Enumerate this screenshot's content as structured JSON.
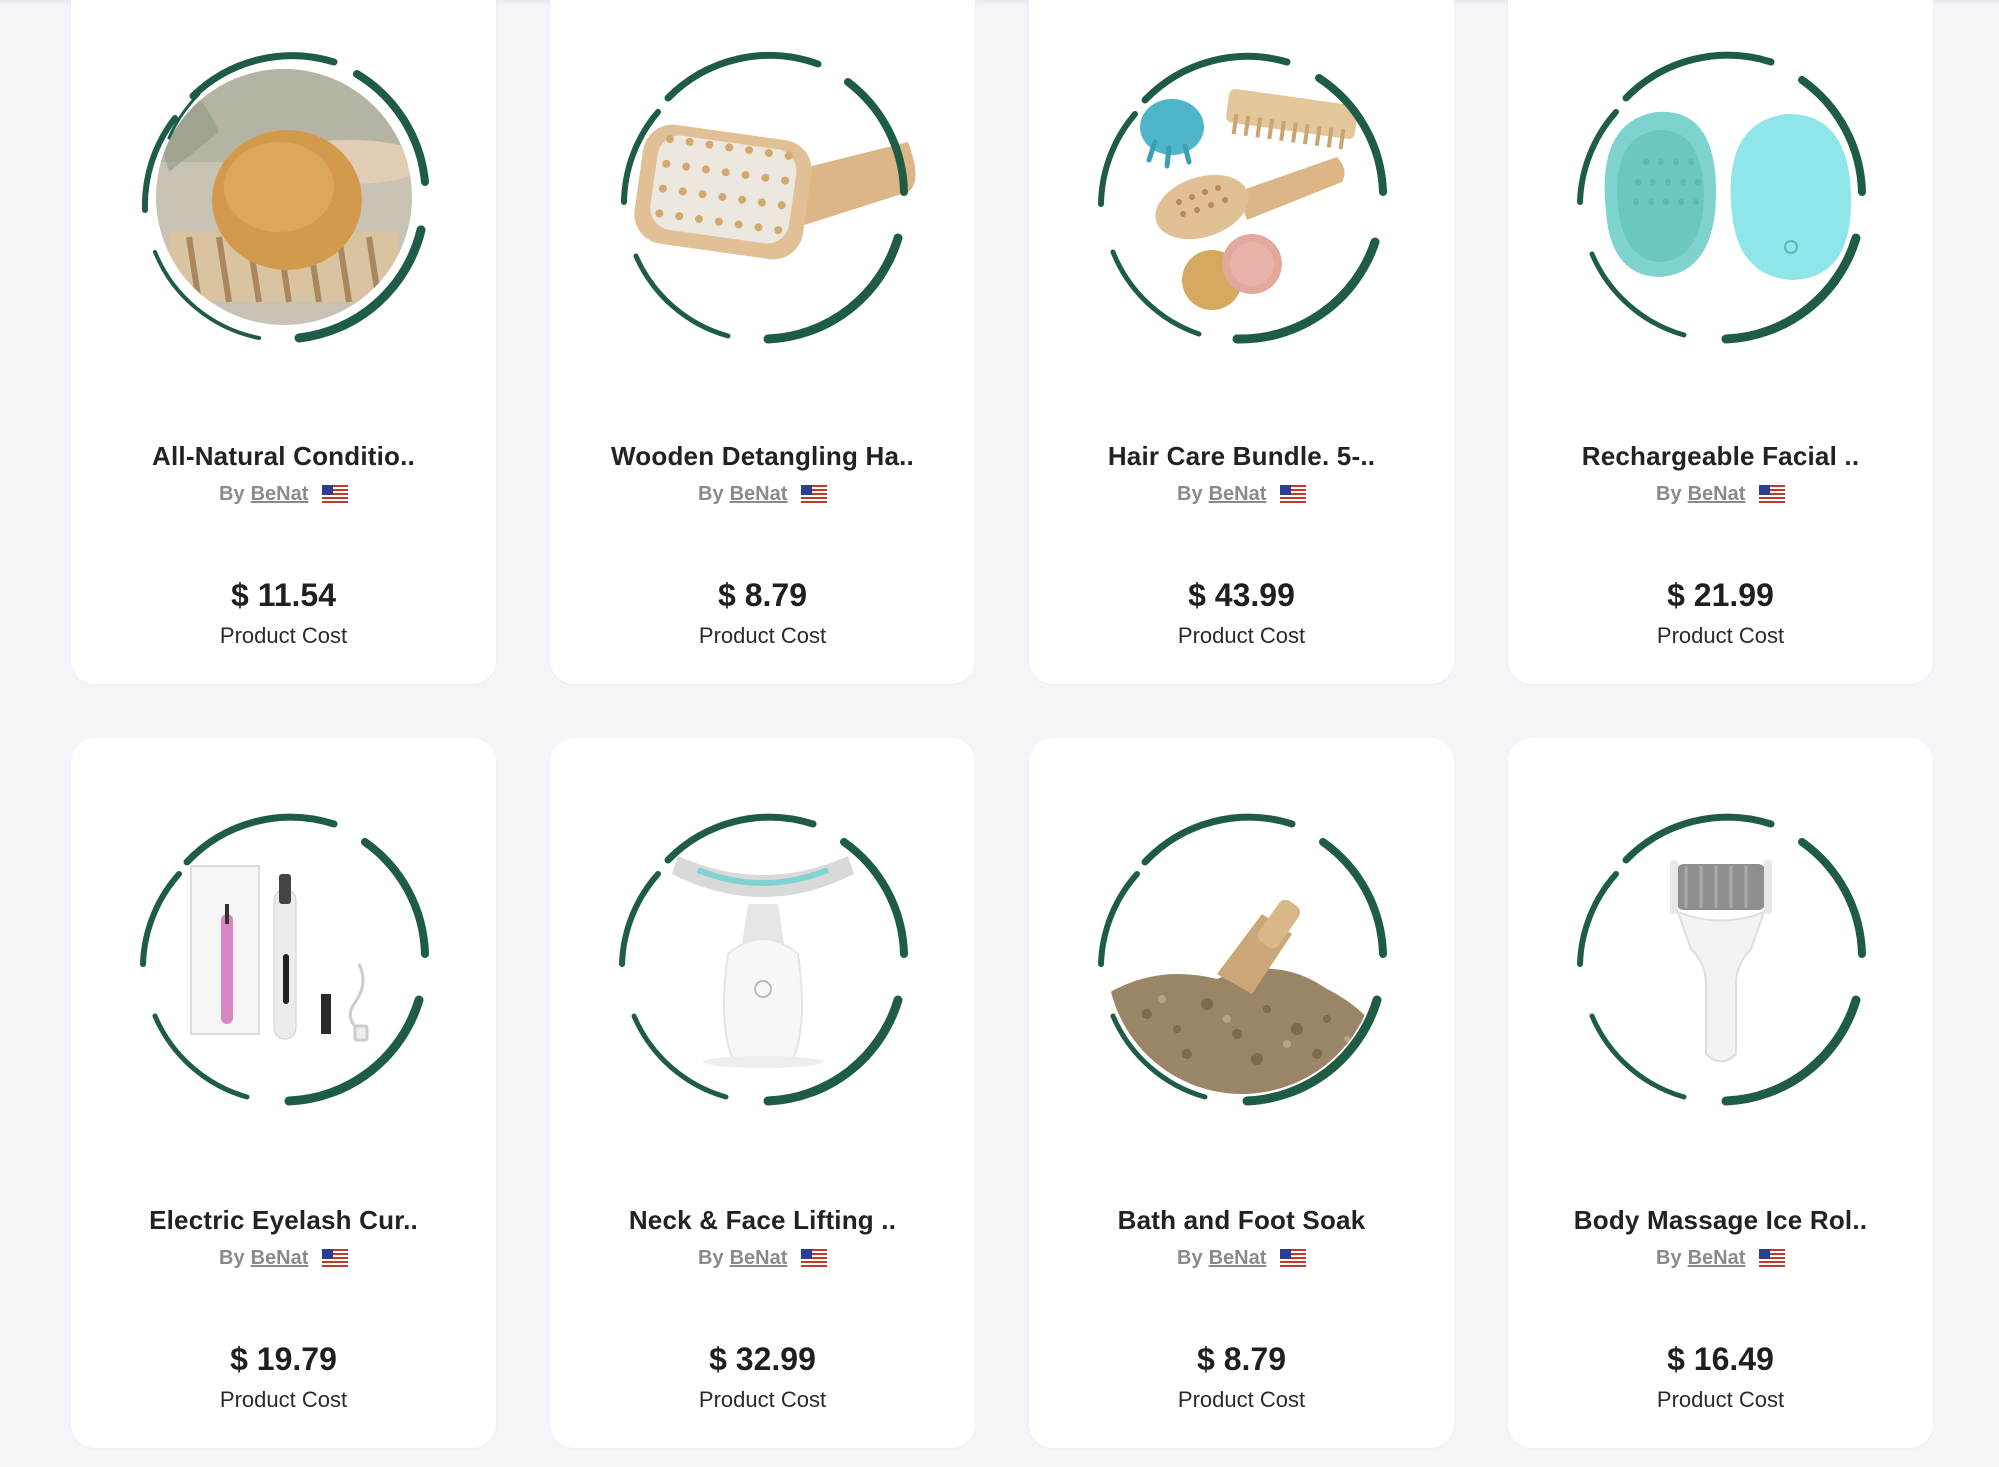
{
  "colors": {
    "ring": "#1f5c45",
    "page_background": "#f4f5f8",
    "card_background": "#ffffff"
  },
  "common": {
    "by_label": "By",
    "vendor_name": "BeNat",
    "flag_icon": "us-flag-icon",
    "cost_label": "Product Cost"
  },
  "products": [
    {
      "title": "All-Natural Conditio..",
      "price": "$ 11.54",
      "image": "conditioner-bar-image"
    },
    {
      "title": "Wooden Detangling Ha..",
      "price": "$ 8.79",
      "image": "wooden-hairbrush-image"
    },
    {
      "title": "Hair Care Bundle. 5-..",
      "price": "$ 43.99",
      "image": "hair-care-bundle-image"
    },
    {
      "title": "Rechargeable Facial ..",
      "price": "$ 21.99",
      "image": "facial-cleansing-brush-image"
    },
    {
      "title": "Electric Eyelash Cur..",
      "price": "$ 19.79",
      "image": "eyelash-curler-image"
    },
    {
      "title": "Neck & Face Lifting ..",
      "price": "$ 32.99",
      "image": "neck-face-device-image"
    },
    {
      "title": "Bath and Foot Soak",
      "price": "$ 8.79",
      "image": "foot-soak-image"
    },
    {
      "title": "Body Massage Ice Rol..",
      "price": "$ 16.49",
      "image": "ice-roller-image"
    }
  ]
}
